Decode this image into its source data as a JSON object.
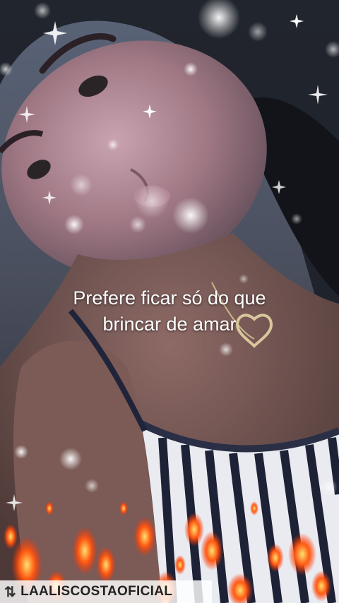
{
  "caption": {
    "line1": "Prefere ficar só do que",
    "line2": "brincar de amar"
  },
  "watermark": {
    "text": "LAALISCOSTAOFICIAL",
    "icon": "repost-icon"
  },
  "colors": {
    "caption": "#ffffff",
    "watermark_bg": "#ffffffd0",
    "fire": "#ff5a12"
  }
}
